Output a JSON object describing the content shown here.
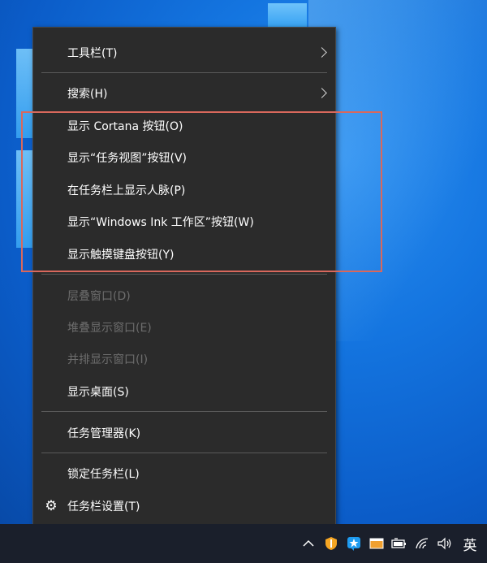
{
  "menu": {
    "items": [
      {
        "label": "工具栏(T)",
        "submenu": true
      },
      {
        "label": "搜索(H)",
        "submenu": true
      },
      {
        "label": "显示 Cortana 按钮(O)"
      },
      {
        "label": "显示“任务视图”按钮(V)"
      },
      {
        "label": "在任务栏上显示人脉(P)"
      },
      {
        "label": "显示“Windows Ink 工作区”按钮(W)"
      },
      {
        "label": "显示触摸键盘按钮(Y)"
      },
      {
        "label": "层叠窗口(D)",
        "disabled": true
      },
      {
        "label": "堆叠显示窗口(E)",
        "disabled": true
      },
      {
        "label": "并排显示窗口(I)",
        "disabled": true
      },
      {
        "label": "显示桌面(S)"
      },
      {
        "label": "任务管理器(K)"
      },
      {
        "label": "锁定任务栏(L)"
      },
      {
        "label": "任务栏设置(T)",
        "icon": "gear-icon"
      }
    ]
  },
  "tray": {
    "icons": [
      "chevron-up-icon",
      "shield-icon",
      "app-star-icon",
      "window-icon",
      "battery-icon",
      "wifi-icon",
      "volume-icon"
    ],
    "ime_label": "英"
  },
  "colors": {
    "menu_bg": "#2b2b2b",
    "highlight_border": "#d9685c",
    "disabled_text": "#6d6d6d",
    "taskbar_bg": "#1a1f2b"
  }
}
